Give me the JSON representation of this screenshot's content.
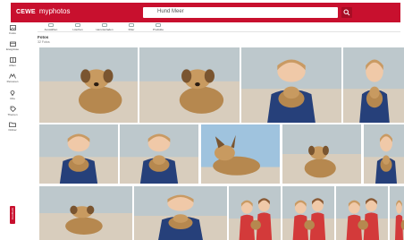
{
  "app": {
    "brand": "CEWE",
    "name": "myphotos"
  },
  "search": {
    "value": "Hund Meer"
  },
  "toolbar": [
    {
      "label": "Auswählen",
      "icon": "select-icon",
      "disabled": false
    },
    {
      "label": "Löschen",
      "icon": "delete-icon",
      "disabled": true
    },
    {
      "label": "Herunterladen",
      "icon": "download-icon",
      "disabled": true
    },
    {
      "label": "Filter",
      "icon": "filter-icon",
      "disabled": false
    },
    {
      "label": "Produkte",
      "icon": "products-icon",
      "disabled": false
    }
  ],
  "sidebar": [
    {
      "label": "Fotos",
      "icon": "photos-icon"
    },
    {
      "label": "Ereignisse",
      "icon": "events-icon"
    },
    {
      "label": "Alben",
      "icon": "albums-icon"
    },
    {
      "label": "Personen",
      "icon": "people-icon"
    },
    {
      "label": "Orte",
      "icon": "places-icon"
    },
    {
      "label": "Themen",
      "icon": "topics-icon"
    },
    {
      "label": "Ordner",
      "icon": "folder-icon"
    }
  ],
  "feedback": "Feedback",
  "folder": {
    "title": "Fotos",
    "count": "32 Fotos"
  },
  "colors": {
    "brand_red": "#c8102e",
    "sand": "#d8cdbd",
    "sea": "#bdc8cc",
    "sky": "#9fc3de",
    "dog": "#b6884f",
    "jacket": "#26407a",
    "hair": "#c99a63"
  },
  "photos": [
    {
      "kind": "dog-beach"
    },
    {
      "kind": "dog-beach"
    },
    {
      "kind": "girl-dog"
    },
    {
      "kind": "girl-dog"
    },
    {
      "kind": "girl-dog"
    },
    {
      "kind": "girl-dog"
    },
    {
      "kind": "dog-sky"
    },
    {
      "kind": "dog-beach-small"
    },
    {
      "kind": "girl-dog"
    },
    {
      "kind": "dog-beach-small"
    },
    {
      "kind": "girl-dog"
    },
    {
      "kind": "kids-red"
    },
    {
      "kind": "kids-red"
    },
    {
      "kind": "kids-red"
    },
    {
      "kind": "kids-red"
    }
  ]
}
